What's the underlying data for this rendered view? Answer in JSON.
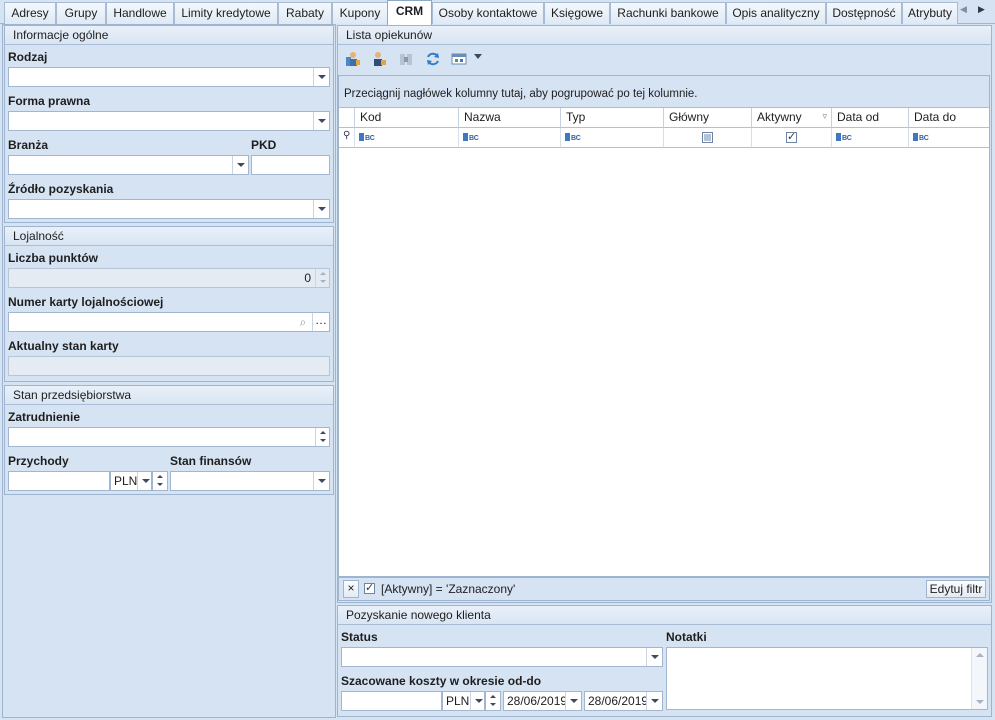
{
  "tabs": [
    "Adresy",
    "Grupy",
    "Handlowe",
    "Limity kredytowe",
    "Rabaty",
    "Kupony",
    "CRM",
    "Osoby kontaktowe",
    "Księgowe",
    "Rachunki bankowe",
    "Opis analityczny",
    "Dostępność",
    "Atrybuty"
  ],
  "active_tab": "CRM",
  "info": {
    "title": "Informacje ogólne",
    "rodzaj_label": "Rodzaj",
    "forma_label": "Forma prawna",
    "branza_label": "Branża",
    "pkd_label": "PKD",
    "zrodlo_label": "Źródło pozyskania"
  },
  "lojalnosc": {
    "title": "Lojalność",
    "punkty_label": "Liczba punktów",
    "punkty_value": "0",
    "karta_label": "Numer karty lojalnościowej",
    "stan_label": "Aktualny stan karty"
  },
  "stan": {
    "title": "Stan przedsiębiorstwa",
    "zatrudnienie_label": "Zatrudnienie",
    "przychody_label": "Przychody",
    "waluta": "PLN",
    "finanse_label": "Stan finansów"
  },
  "opiekunowie": {
    "title": "Lista opiekunów",
    "groupby_hint": "Przeciągnij nagłówek kolumny tutaj, aby pogrupować po tej kolumnie.",
    "columns": [
      "Kod",
      "Nazwa",
      "Typ",
      "Główny",
      "Aktywny",
      "Data od",
      "Data do"
    ],
    "filter_text": "[Aktywny] = 'Zaznaczony'",
    "edit_filter": "Edytuj filtr",
    "close_filter": "×"
  },
  "pozyskanie": {
    "title": "Pozyskanie nowego klienta",
    "status_label": "Status",
    "notatki_label": "Notatki",
    "koszty_label": "Szacowane koszty w okresie od-do",
    "waluta": "PLN",
    "date_from": "28/06/2019",
    "date_to": "28/06/2019"
  }
}
